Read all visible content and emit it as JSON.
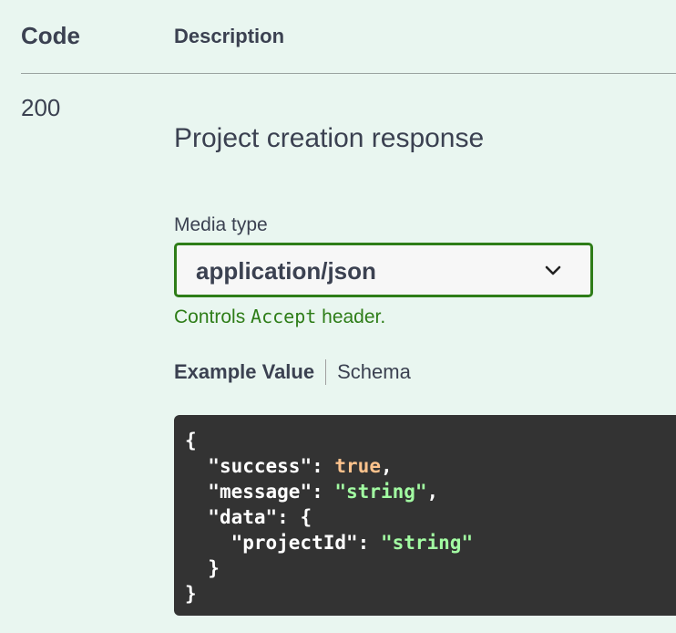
{
  "table": {
    "code_header": "Code",
    "description_header": "Description"
  },
  "response": {
    "code": "200",
    "description": "Project creation response"
  },
  "media": {
    "label": "Media type",
    "selected": "application/json",
    "controls_prefix": "Controls",
    "controls_mono": "Accept",
    "controls_suffix": "header."
  },
  "tabs": {
    "example_value": "Example Value",
    "schema": "Schema"
  },
  "example": {
    "open_brace": "{",
    "success_key": "\"success\"",
    "success_val": "true",
    "message_key": "\"message\"",
    "message_val": "\"string\"",
    "data_key": "\"data\"",
    "project_key": "\"projectId\"",
    "project_val": "\"string\"",
    "inner_close": "}",
    "close_brace": "}"
  },
  "colors": {
    "background": "#e9f6f0",
    "accent_green": "#2e7d18",
    "code_bg": "#333333",
    "code_bool": "#fcc28c",
    "code_string": "#a2fca2"
  }
}
